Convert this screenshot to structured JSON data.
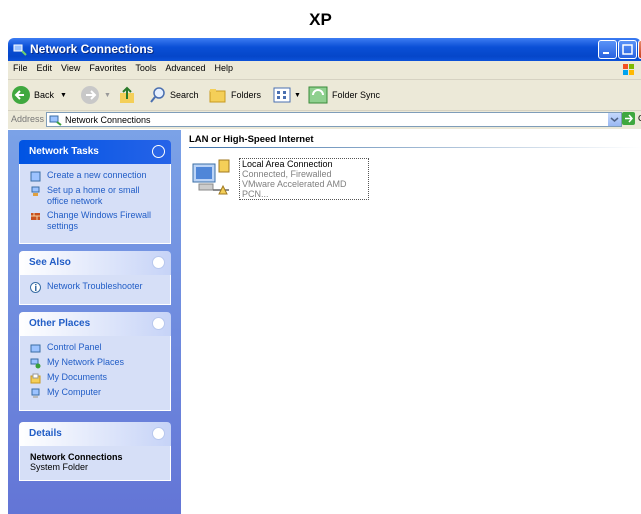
{
  "caption": "XP",
  "window": {
    "title": "Network Connections"
  },
  "menu": [
    "File",
    "Edit",
    "View",
    "Favorites",
    "Tools",
    "Advanced",
    "Help"
  ],
  "toolbar": {
    "back": "Back",
    "search": "Search",
    "folders": "Folders",
    "folder_sync": "Folder Sync"
  },
  "address": {
    "label": "Address",
    "value": "Network Connections",
    "go": "Go"
  },
  "panels": {
    "network_tasks": {
      "title": "Network Tasks",
      "items": [
        "Create a new connection",
        "Set up a home or small office network",
        "Change Windows Firewall settings"
      ]
    },
    "see_also": {
      "title": "See Also",
      "items": [
        "Network Troubleshooter"
      ]
    },
    "other_places": {
      "title": "Other Places",
      "items": [
        "Control Panel",
        "My Network Places",
        "My Documents",
        "My Computer"
      ]
    },
    "details": {
      "title": "Details",
      "name": "Network Connections",
      "sub": "System Folder"
    }
  },
  "group": {
    "title": "LAN or High-Speed Internet"
  },
  "connection": {
    "name": "Local Area Connection",
    "status": "Connected, Firewalled",
    "device": "VMware Accelerated AMD PCN..."
  },
  "colors": {
    "title_bar": "#0a4fd6",
    "left_pane": "#6f8ede",
    "link": "#215dc6"
  }
}
